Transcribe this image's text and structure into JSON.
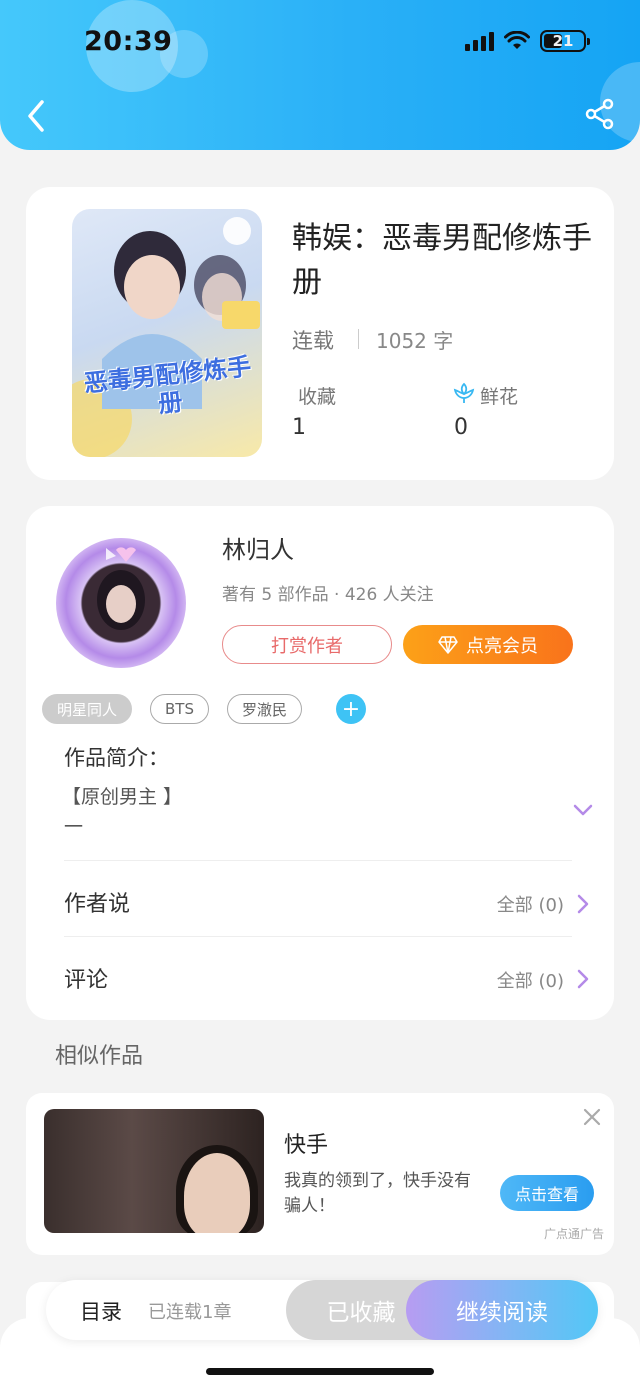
{
  "status_bar": {
    "time": "20:39",
    "battery": "21"
  },
  "book": {
    "title": "韩娱：恶毒男配修炼手册",
    "cover_text": "恶毒男配修炼手册",
    "status": "连载",
    "words": "1052 字",
    "favorites_label": "收藏",
    "favorites_value": "1",
    "flowers_label": "鲜花",
    "flowers_value": "0"
  },
  "author": {
    "name": "林归人",
    "meta": "著有 5 部作品 · 426 人关注",
    "reward_label": "打赏作者",
    "vip_label": "点亮会员"
  },
  "tags": [
    "明星同人",
    "BTS",
    "罗澈民"
  ],
  "intro": {
    "label": "作品简介：",
    "text": "【原创男主 】",
    "dash": "一"
  },
  "author_says": {
    "label": "作者说",
    "value": "全部 (0)"
  },
  "comments": {
    "label": "评论",
    "value": "全部 (0)"
  },
  "similar": {
    "title": "相似作品"
  },
  "ad": {
    "title": "快手",
    "desc": "我真的领到了，快手没有骗人！",
    "button": "点击查看",
    "source": "广点通广告"
  },
  "bottom_bar": {
    "toc": "目录",
    "toc_meta": "已连载1章",
    "collected": "已收藏",
    "read": "继续阅读"
  },
  "colors": {
    "header": "#2ab0f7",
    "vip": "#f9731b",
    "reward": "#e86a6a",
    "accent_purple": "#b48ae8"
  }
}
